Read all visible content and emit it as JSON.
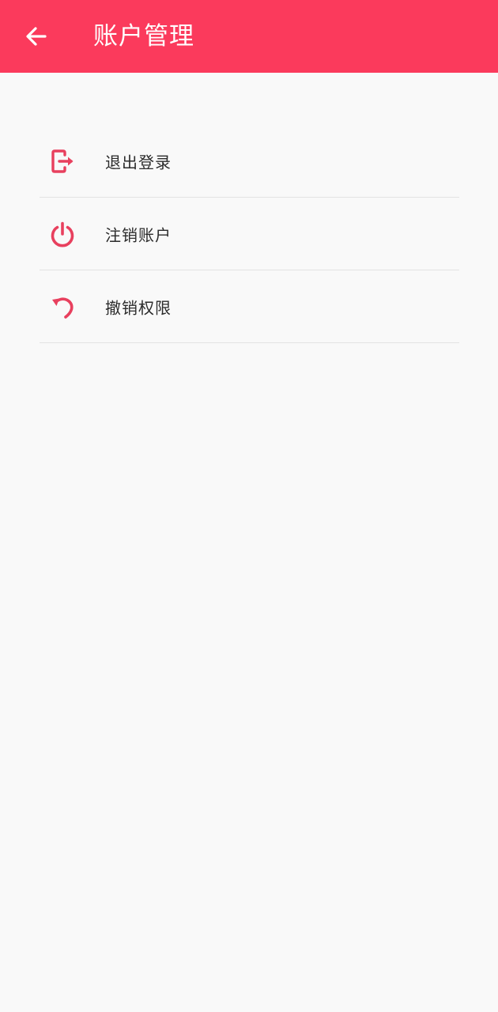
{
  "header": {
    "title": "账户管理",
    "back_icon": "arrow-left-icon"
  },
  "colors": {
    "accent": "#fb3a5c",
    "icon": "#e8405e",
    "background": "#f9f9f9",
    "divider": "#e3e3e3",
    "text": "#2b2b2b"
  },
  "menu": {
    "items": [
      {
        "label": "退出登录",
        "icon": "logout-icon"
      },
      {
        "label": "注销账户",
        "icon": "power-icon"
      },
      {
        "label": "撤销权限",
        "icon": "undo-icon"
      }
    ]
  }
}
